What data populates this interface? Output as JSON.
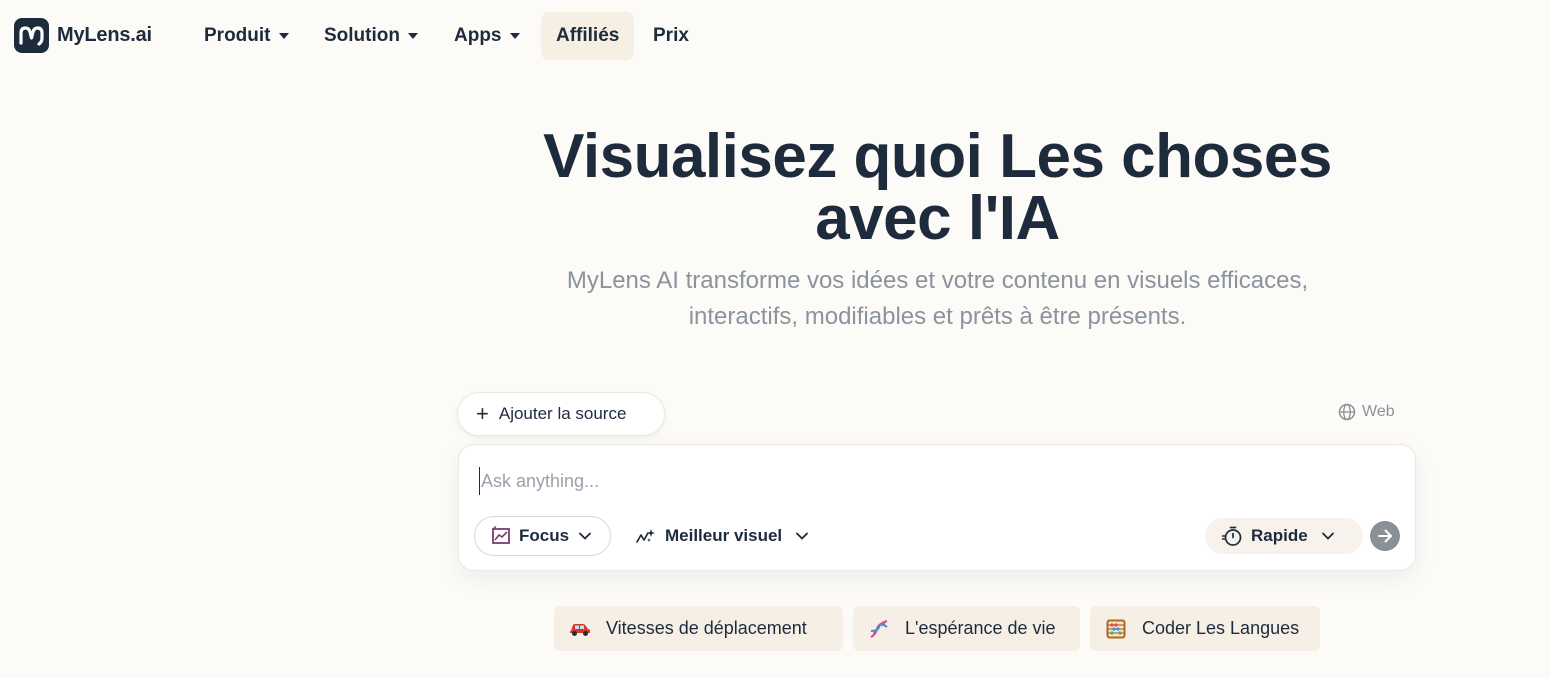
{
  "brand": {
    "name": "MyLens.ai"
  },
  "nav": {
    "items": [
      {
        "label": "Produit",
        "dropdown": true
      },
      {
        "label": "Solution",
        "dropdown": true
      },
      {
        "label": "Apps",
        "dropdown": true
      },
      {
        "label": "Affiliés",
        "dropdown": false,
        "active": true
      },
      {
        "label": "Prix",
        "dropdown": false
      }
    ]
  },
  "hero": {
    "title_line1": "Visualisez quoi Les choses",
    "title_line2": "avec l'IA",
    "subtitle_line1": "MyLens AI transforme vos idées et votre contenu en visuels efficaces,",
    "subtitle_line2": "interactifs, modifiables et prêts à être présents."
  },
  "composer": {
    "add_source_label": "Ajouter la source",
    "web_label": "Web",
    "input_placeholder": "Ask anything...",
    "focus_label": "Focus",
    "best_visual_label": "Meilleur visuel",
    "speed_label": "Rapide"
  },
  "suggestions": [
    {
      "label": "Vitesses de déplacement",
      "icon": "car-icon"
    },
    {
      "label": "L'espérance de vie",
      "icon": "dna-icon"
    },
    {
      "label": "Coder Les Langues",
      "icon": "abacus-icon"
    }
  ],
  "colors": {
    "background": "#fdfbf7",
    "brand_dark": "#1e2b3c",
    "muted_text": "#8a939e",
    "chip_bg": "#f5efe5",
    "send_button": "#8b8f96",
    "focus_icon": "#7b3b6e"
  }
}
